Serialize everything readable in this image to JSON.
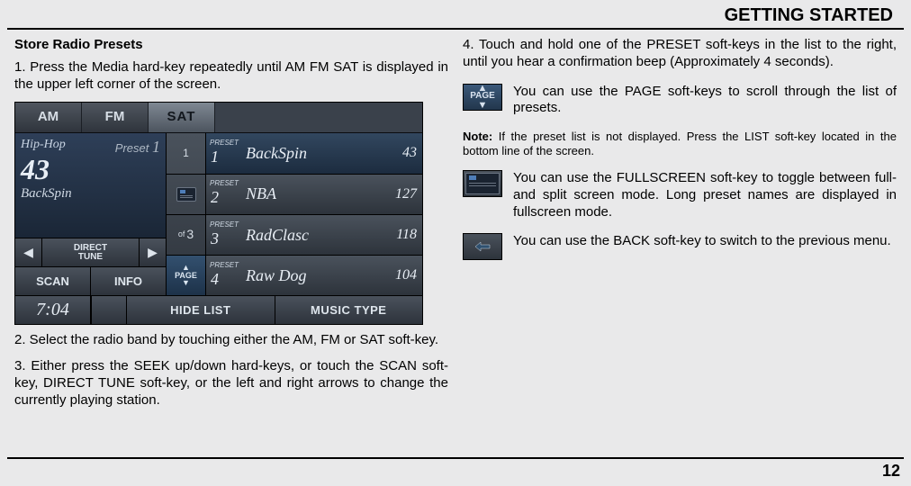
{
  "header": {
    "title": "GETTING STARTED"
  },
  "left": {
    "section_title": "Store Radio Presets",
    "step1": "1. Press the Media hard-key repeatedly until AM FM SAT is displayed in the upper left corner of the screen.",
    "step2": "2. Select the radio band by touching either the AM, FM or SAT soft-key.",
    "step3": "3. Either press the SEEK up/down hard-keys, or touch the SCAN soft-key, DIRECT TUNE soft-key, or the left and right arrows to change the currently playing station."
  },
  "screenshot": {
    "tabs": {
      "am": "AM",
      "fm": "FM",
      "sat": "SAT"
    },
    "nowplaying": {
      "category": "Hip-Hop",
      "preset_label": "Preset",
      "preset_num": "1",
      "channel": "43",
      "name": "BackSpin"
    },
    "direct_tune": {
      "left": "◀",
      "label1": "DIRECT",
      "label2": "TUNE",
      "right": "▶"
    },
    "scan": "SCAN",
    "info": "INFO",
    "mid": {
      "up": "1",
      "of_label": "of",
      "of_num": "3",
      "page_arrows": "▲",
      "page_arrows2": "▼",
      "page_label": "PAGE"
    },
    "presets": [
      {
        "label": "PRESET",
        "num": "1",
        "name": "BackSpin",
        "ch": "43"
      },
      {
        "label": "PRESET",
        "num": "2",
        "name": "NBA",
        "ch": "127"
      },
      {
        "label": "PRESET",
        "num": "3",
        "name": "RadClasc",
        "ch": "118"
      },
      {
        "label": "PRESET",
        "num": "4",
        "name": "Raw Dog",
        "ch": "104"
      }
    ],
    "clock": "7:04",
    "hide_list": "HIDE LIST",
    "music_type": "MUSIC TYPE"
  },
  "right": {
    "step4": "4. Touch and hold one of the PRESET soft-keys in the list to the right, until you hear a confirmation beep (Approximately 4 seconds).",
    "page_text": "You can use the PAGE soft-keys to scroll through the list of presets.",
    "page_label": "PAGE",
    "note_label": "Note:",
    "note_text": " If the preset list is not displayed. Press the LIST soft-key located in the bottom line of the screen.",
    "fs_text": "You can use the FULLSCREEN soft-key to toggle between full- and split screen mode. Long preset names are displayed in fullscreen mode.",
    "back_text": "You can use the BACK soft-key to switch to the previous menu."
  },
  "page_number": "12"
}
